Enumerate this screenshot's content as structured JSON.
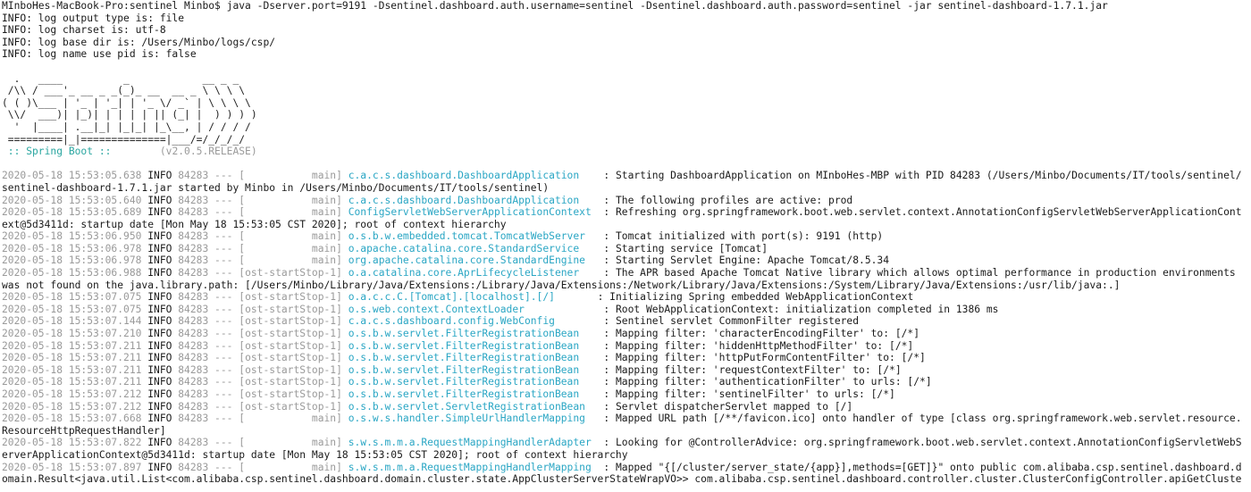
{
  "prompt": "MInboHes-MacBook-Pro:sentinel Minbo$ java -Dserver.port=9191 -Dsentinel.dashboard.auth.username=sentinel -Dsentinel.dashboard.auth.password=sentinel -jar sentinel-dashboard-1.7.1.jar",
  "info_lines": [
    "INFO: log output type is: file",
    "INFO: log charset is: utf-8",
    "INFO: log base dir is: /Users/Minbo/logs/csp/",
    "INFO: log name use pid is: false"
  ],
  "banner": [
    "  .   ____          _            __ _ _",
    " /\\\\ / ___'_ __ _ _(_)_ __  __ _ \\ \\ \\ \\",
    "( ( )\\___ | '_ | '_| | '_ \\/ _` | \\ \\ \\ \\",
    " \\\\/  ___)| |_)| | | | | || (_| |  ) ) ) )",
    "  '  |____| .__|_| |_|_| |_\\__, | / / / /",
    " =========|_|==============|___/=/_/_/_/"
  ],
  "spring_boot_label": " :: Spring Boot :: ",
  "spring_boot_version": "       (v2.0.5.RELEASE)",
  "log_entries": [
    {
      "ts": "2020-05-18 15:53:05.638",
      "level": " INFO",
      "pid": " 84283 --- [",
      "thread": "           main]",
      "logger": " c.a.c.s.dashboard.DashboardApplication  ",
      "msg": "  : Starting DashboardApplication on MInboHes-MBP with PID 84283 (/Users/Minbo/Documents/IT/tools/sentinel/",
      "cont": "sentinel-dashboard-1.7.1.jar started by Minbo in /Users/Minbo/Documents/IT/tools/sentinel)"
    },
    {
      "ts": "2020-05-18 15:53:05.640",
      "level": " INFO",
      "pid": " 84283 --- [",
      "thread": "           main]",
      "logger": " c.a.c.s.dashboard.DashboardApplication  ",
      "msg": "  : The following profiles are active: prod"
    },
    {
      "ts": "2020-05-18 15:53:05.689",
      "level": " INFO",
      "pid": " 84283 --- [",
      "thread": "           main]",
      "logger": " ConfigServletWebServerApplicationContext",
      "msg": "  : Refreshing org.springframework.boot.web.servlet.context.AnnotationConfigServletWebServerApplicationCont",
      "cont": "ext@5d3411d: startup date [Mon May 18 15:53:05 CST 2020]; root of context hierarchy"
    },
    {
      "ts": "2020-05-18 15:53:06.950",
      "level": " INFO",
      "pid": " 84283 --- [",
      "thread": "           main]",
      "logger": " o.s.b.w.embedded.tomcat.TomcatWebServer ",
      "msg": "  : Tomcat initialized with port(s): 9191 (http)"
    },
    {
      "ts": "2020-05-18 15:53:06.978",
      "level": " INFO",
      "pid": " 84283 --- [",
      "thread": "           main]",
      "logger": " o.apache.catalina.core.StandardService  ",
      "msg": "  : Starting service [Tomcat]"
    },
    {
      "ts": "2020-05-18 15:53:06.978",
      "level": " INFO",
      "pid": " 84283 --- [",
      "thread": "           main]",
      "logger": " org.apache.catalina.core.StandardEngine ",
      "msg": "  : Starting Servlet Engine: Apache Tomcat/8.5.34"
    },
    {
      "ts": "2020-05-18 15:53:06.988",
      "level": " INFO",
      "pid": " 84283 --- [",
      "thread": "ost-startStop-1]",
      "logger": " o.a.catalina.core.AprLifecycleListener  ",
      "msg": "  : The APR based Apache Tomcat Native library which allows optimal performance in production environments",
      "cont": "was not found on the java.library.path: [/Users/Minbo/Library/Java/Extensions:/Library/Java/Extensions:/Network/Library/Java/Extensions:/System/Library/Java/Extensions:/usr/lib/java:.]"
    },
    {
      "ts": "2020-05-18 15:53:07.075",
      "level": " INFO",
      "pid": " 84283 --- [",
      "thread": "ost-startStop-1]",
      "logger": " o.a.c.c.C.[Tomcat].[localhost].[/]     ",
      "msg": "  : Initializing Spring embedded WebApplicationContext"
    },
    {
      "ts": "2020-05-18 15:53:07.075",
      "level": " INFO",
      "pid": " 84283 --- [",
      "thread": "ost-startStop-1]",
      "logger": " o.s.web.context.ContextLoader           ",
      "msg": "  : Root WebApplicationContext: initialization completed in 1386 ms"
    },
    {
      "ts": "2020-05-18 15:53:07.144",
      "level": " INFO",
      "pid": " 84283 --- [",
      "thread": "ost-startStop-1]",
      "logger": " c.a.c.s.dashboard.config.WebConfig      ",
      "msg": "  : Sentinel servlet CommonFilter registered"
    },
    {
      "ts": "2020-05-18 15:53:07.210",
      "level": " INFO",
      "pid": " 84283 --- [",
      "thread": "ost-startStop-1]",
      "logger": " o.s.b.w.servlet.FilterRegistrationBean  ",
      "msg": "  : Mapping filter: 'characterEncodingFilter' to: [/*]"
    },
    {
      "ts": "2020-05-18 15:53:07.211",
      "level": " INFO",
      "pid": " 84283 --- [",
      "thread": "ost-startStop-1]",
      "logger": " o.s.b.w.servlet.FilterRegistrationBean  ",
      "msg": "  : Mapping filter: 'hiddenHttpMethodFilter' to: [/*]"
    },
    {
      "ts": "2020-05-18 15:53:07.211",
      "level": " INFO",
      "pid": " 84283 --- [",
      "thread": "ost-startStop-1]",
      "logger": " o.s.b.w.servlet.FilterRegistrationBean  ",
      "msg": "  : Mapping filter: 'httpPutFormContentFilter' to: [/*]"
    },
    {
      "ts": "2020-05-18 15:53:07.211",
      "level": " INFO",
      "pid": " 84283 --- [",
      "thread": "ost-startStop-1]",
      "logger": " o.s.b.w.servlet.FilterRegistrationBean  ",
      "msg": "  : Mapping filter: 'requestContextFilter' to: [/*]"
    },
    {
      "ts": "2020-05-18 15:53:07.211",
      "level": " INFO",
      "pid": " 84283 --- [",
      "thread": "ost-startStop-1]",
      "logger": " o.s.b.w.servlet.FilterRegistrationBean  ",
      "msg": "  : Mapping filter: 'authenticationFilter' to urls: [/*]"
    },
    {
      "ts": "2020-05-18 15:53:07.212",
      "level": " INFO",
      "pid": " 84283 --- [",
      "thread": "ost-startStop-1]",
      "logger": " o.s.b.w.servlet.FilterRegistrationBean  ",
      "msg": "  : Mapping filter: 'sentinelFilter' to urls: [/*]"
    },
    {
      "ts": "2020-05-18 15:53:07.212",
      "level": " INFO",
      "pid": " 84283 --- [",
      "thread": "ost-startStop-1]",
      "logger": " o.s.b.w.servlet.ServletRegistrationBean ",
      "msg": "  : Servlet dispatcherServlet mapped to [/]"
    },
    {
      "ts": "2020-05-18 15:53:07.668",
      "level": " INFO",
      "pid": " 84283 --- [",
      "thread": "           main]",
      "logger": " o.s.w.s.handler.SimpleUrlHandlerMapping ",
      "msg": "  : Mapped URL path [/**/favicon.ico] onto handler of type [class org.springframework.web.servlet.resource.",
      "cont": "ResourceHttpRequestHandler]"
    },
    {
      "ts": "2020-05-18 15:53:07.822",
      "level": " INFO",
      "pid": " 84283 --- [",
      "thread": "           main]",
      "logger": " s.w.s.m.m.a.RequestMappingHandlerAdapter",
      "msg": "  : Looking for @ControllerAdvice: org.springframework.boot.web.servlet.context.AnnotationConfigServletWebS",
      "cont": "erverApplicationContext@5d3411d: startup date [Mon May 18 15:53:05 CST 2020]; root of context hierarchy"
    },
    {
      "ts": "2020-05-18 15:53:07.897",
      "level": " INFO",
      "pid": " 84283 --- [",
      "thread": "           main]",
      "logger": " s.w.s.m.m.a.RequestMappingHandlerMapping",
      "msg": "  : Mapped \"{[/cluster/server_state/{app}],methods=[GET]}\" onto public com.alibaba.csp.sentinel.dashboard.d",
      "cont": "omain.Result<java.util.List<com.alibaba.csp.sentinel.dashboard.domain.cluster.state.AppClusterServerStateWrapVO>> com.alibaba.csp.sentinel.dashboard.controller.cluster.ClusterConfigController.apiGetCluste"
    }
  ],
  "colors": {
    "background": "#ffffff",
    "text": "#1a1a1a",
    "dim": "#9a9a9a",
    "logger": "#2aa6c4",
    "spring": "#2aa6a0"
  }
}
